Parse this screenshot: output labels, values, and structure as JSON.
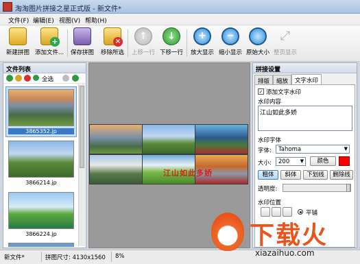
{
  "window": {
    "title": "淘淘图片拼接之星正式版 - 新文件*"
  },
  "menu": [
    "文件(F)",
    "编辑(E)",
    "视图(V)",
    "帮助(H)"
  ],
  "toolbar": [
    {
      "label": "新建拼图",
      "icon": "new-puzzle-icon",
      "enabled": true
    },
    {
      "label": "添加文件...",
      "icon": "add-file-icon",
      "enabled": true
    },
    {
      "label": "保存拼图",
      "icon": "save-icon",
      "enabled": true
    },
    {
      "label": "移除所选",
      "icon": "remove-icon",
      "enabled": true
    },
    {
      "label": "上移一行",
      "icon": "move-up-icon",
      "enabled": false
    },
    {
      "label": "下移一行",
      "icon": "move-down-icon",
      "enabled": true
    },
    {
      "label": "放大显示",
      "icon": "zoom-in-icon",
      "enabled": true
    },
    {
      "label": "缩小显示",
      "icon": "zoom-out-icon",
      "enabled": true
    },
    {
      "label": "原始大小",
      "icon": "original-size-icon",
      "enabled": true
    },
    {
      "label": "整页显示",
      "icon": "fit-page-icon",
      "enabled": false
    }
  ],
  "file_list": {
    "title": "文件列表",
    "select_all": "全选",
    "items": [
      {
        "name": "3865352.jp",
        "selected": true
      },
      {
        "name": "3866214.jp",
        "selected": false
      },
      {
        "name": "3866224.jp",
        "selected": false
      }
    ]
  },
  "canvas": {
    "watermark": "江山如此多娇"
  },
  "settings": {
    "title": "拼接设置",
    "tabs": [
      "排版",
      "缩放",
      "文字水印"
    ],
    "active_tab": "文字水印",
    "add_watermark_label": "添加文字水印",
    "add_watermark_checked": true,
    "content_label": "水印内容",
    "content_value": "江山如此多娇",
    "font_section": "水印字体",
    "font_label": "字体:",
    "font_value": "Tahoma",
    "size_label": "大小:",
    "size_value": "200",
    "color_button": "颜色",
    "color_value": "#ff0000",
    "style_buttons": [
      "粗体",
      "斜体",
      "下划线",
      "删除线"
    ],
    "opacity_label": "透明度:",
    "position_label": "水印位置",
    "tile_option": "平铺"
  },
  "statusbar": {
    "file": "新文件*",
    "size": "拼图尺寸: 4130x1560",
    "zoom": "8%"
  },
  "brand": {
    "name": "下载火",
    "url": "xiazaihuo.com",
    "color": "#e8541c"
  }
}
